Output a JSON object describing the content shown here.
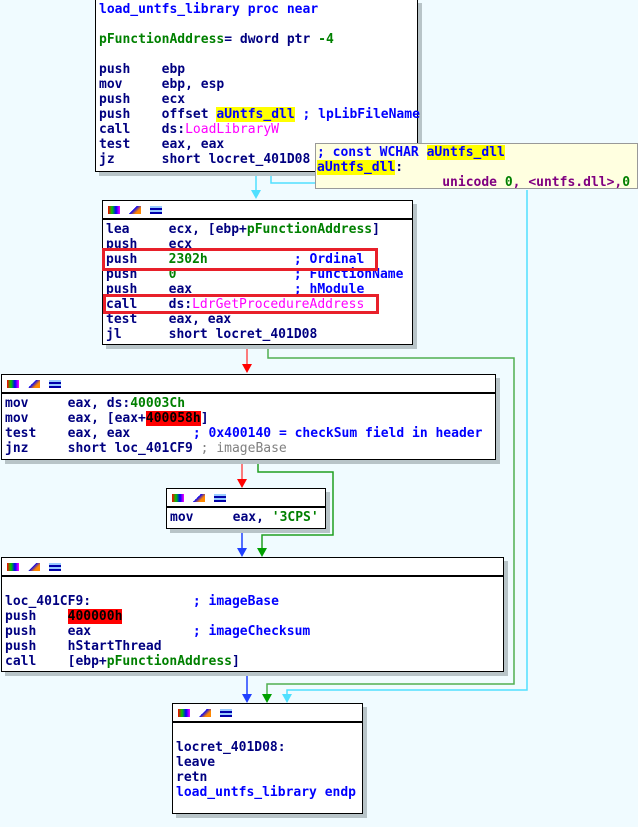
{
  "blocks": [
    {
      "id": "block-entry",
      "lines": [
        [
          {
            "t": "load_untfs_library proc near",
            "c": "b"
          }
        ],
        [],
        [
          {
            "t": "pFunctionAddress",
            "c": "g"
          },
          {
            "t": "= dword ptr ",
            "c": "n"
          },
          {
            "t": "-4",
            "c": "g"
          }
        ],
        [],
        [
          {
            "t": "push    ebp",
            "c": "n"
          }
        ],
        [
          {
            "t": "mov     ebp, esp",
            "c": "n"
          }
        ],
        [
          {
            "t": "push    ecx",
            "c": "n"
          }
        ],
        [
          {
            "t": "push    offset ",
            "c": "n"
          },
          {
            "t": "aUntfs_dll",
            "c": "y"
          },
          {
            "t": " ; lpLibFileName",
            "c": "b"
          }
        ],
        [
          {
            "t": "call    ds:",
            "c": "n"
          },
          {
            "t": "LoadLibraryW",
            "c": "m"
          }
        ],
        [
          {
            "t": "test    eax, eax",
            "c": "n"
          }
        ],
        [
          {
            "t": "jz      short locret_401D08",
            "c": "n"
          }
        ]
      ]
    },
    {
      "id": "block-getproc",
      "lines": [
        [
          {
            "t": "lea     ecx, [ebp+",
            "c": "n"
          },
          {
            "t": "pFunctionAddress",
            "c": "g"
          },
          {
            "t": "]",
            "c": "n"
          }
        ],
        [
          {
            "t": "push    ecx",
            "c": "n"
          }
        ],
        [
          {
            "t": "push    ",
            "c": "n"
          },
          {
            "t": "2302h",
            "c": "g"
          },
          {
            "t": "           ; Ordinal",
            "c": "b"
          }
        ],
        [
          {
            "t": "push    ",
            "c": "n"
          },
          {
            "t": "0",
            "c": "g"
          },
          {
            "t": "               ; FunctionName",
            "c": "b"
          }
        ],
        [
          {
            "t": "push    eax",
            "c": "n"
          },
          {
            "t": "             ; hModule",
            "c": "b"
          }
        ],
        [
          {
            "t": "call    ds:",
            "c": "n"
          },
          {
            "t": "LdrGetProcedureAddress",
            "c": "m"
          }
        ],
        [
          {
            "t": "test    eax, eax",
            "c": "n"
          }
        ],
        [
          {
            "t": "jl      short locret_401D08",
            "c": "n"
          }
        ]
      ]
    },
    {
      "id": "block-checksum",
      "lines": [
        [
          {
            "t": "mov     eax, ds:",
            "c": "n"
          },
          {
            "t": "40003Ch",
            "c": "g"
          }
        ],
        [
          {
            "t": "mov     eax, [eax+",
            "c": "n"
          },
          {
            "t": "400058h",
            "c": "r"
          },
          {
            "t": "]",
            "c": "n"
          }
        ],
        [
          {
            "t": "test    eax, eax",
            "c": "n"
          },
          {
            "t": "        ; 0x400140 = checkSum field in header",
            "c": "b"
          }
        ],
        [
          {
            "t": "jnz     short loc_401CF9",
            "c": "n"
          },
          {
            "t": " ; imageBase",
            "c": "gr"
          }
        ]
      ]
    },
    {
      "id": "block-3cps",
      "lines": [
        [
          {
            "t": "mov     eax, ",
            "c": "n"
          },
          {
            "t": "'3CPS'",
            "c": "g"
          }
        ]
      ]
    },
    {
      "id": "block-thread",
      "lines": [
        [],
        [
          {
            "t": "loc_401CF9:",
            "c": "n"
          },
          {
            "t": "             ; imageBase",
            "c": "b"
          }
        ],
        [
          {
            "t": "push    ",
            "c": "n"
          },
          {
            "t": "400000h",
            "c": "r"
          }
        ],
        [
          {
            "t": "push    eax",
            "c": "n"
          },
          {
            "t": "             ; imageChecksum",
            "c": "b"
          }
        ],
        [
          {
            "t": "push    hStartThread",
            "c": "n"
          }
        ],
        [
          {
            "t": "call    [ebp+",
            "c": "n"
          },
          {
            "t": "pFunctionAddress",
            "c": "g"
          },
          {
            "t": "]",
            "c": "n"
          }
        ]
      ]
    },
    {
      "id": "block-ret",
      "lines": [
        [],
        [
          {
            "t": "locret_401D08:",
            "c": "n"
          }
        ],
        [
          {
            "t": "leave",
            "c": "n"
          }
        ],
        [
          {
            "t": "retn",
            "c": "n"
          }
        ],
        [
          {
            "t": "load_untfs_library endp",
            "c": "b"
          }
        ]
      ]
    }
  ],
  "tooltip": {
    "lines": [
      [
        {
          "t": "; const WCHAR ",
          "c": "b"
        },
        {
          "t": "aUntfs_dll",
          "c": "y"
        }
      ],
      [
        {
          "t": "aUntfs_dll",
          "c": "y"
        },
        {
          "t": ":",
          "c": "n"
        }
      ],
      [
        {
          "t": "                unicode ",
          "c": "p"
        },
        {
          "t": "0",
          "c": "g"
        },
        {
          "t": ", <untfs.dll>,",
          "c": "p"
        },
        {
          "t": "0",
          "c": "g"
        }
      ]
    ]
  },
  "header_icons": [
    "graph-color-icon",
    "edit-icon",
    "comment-icon"
  ],
  "colors": {
    "true_edge": "#00a000",
    "false_edge": "#ff0000",
    "uncond_edge": "#0000ff",
    "highlight_edge": "#00e0ff",
    "annotation_box": "#e8202a"
  }
}
